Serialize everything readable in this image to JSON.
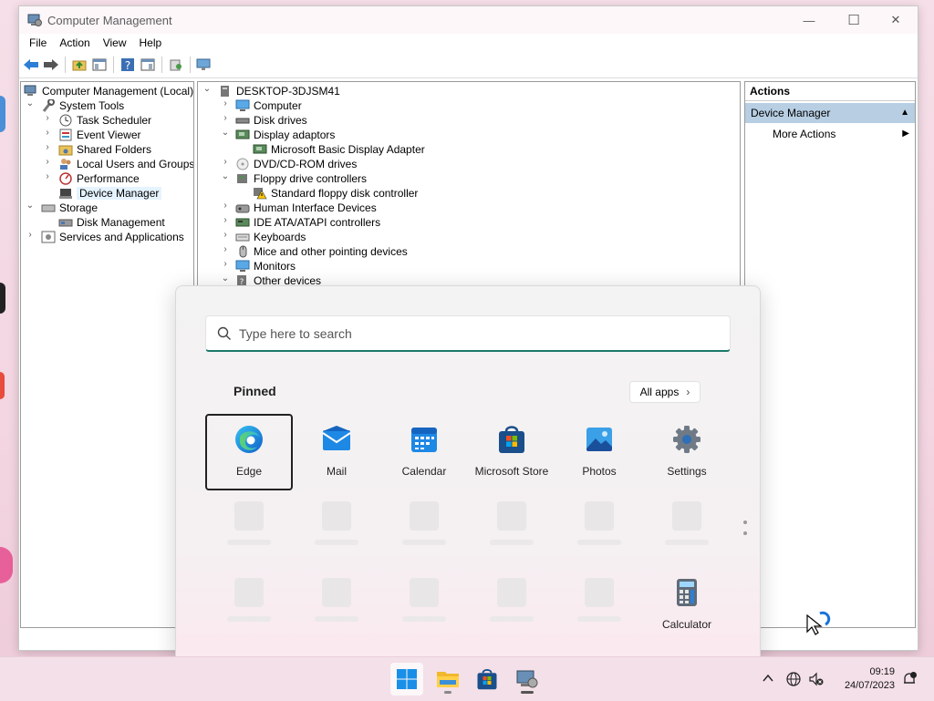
{
  "window": {
    "title": "Computer Management",
    "controls": {
      "minimize": "—",
      "maximize": "☐",
      "close": "✕"
    }
  },
  "menubar": [
    "File",
    "Action",
    "View",
    "Help"
  ],
  "left_tree": {
    "root": "Computer Management (Local)",
    "system_tools": "System Tools",
    "task_scheduler": "Task Scheduler",
    "event_viewer": "Event Viewer",
    "shared_folders": "Shared Folders",
    "local_users": "Local Users and Groups",
    "performance": "Performance",
    "device_manager": "Device Manager",
    "storage": "Storage",
    "disk_management": "Disk Management",
    "services": "Services and Applications"
  },
  "device_tree": {
    "root": "DESKTOP-3DJSM41",
    "computer": "Computer",
    "disk_drives": "Disk drives",
    "display_adaptors": "Display adaptors",
    "display_child": "Microsoft Basic Display Adapter",
    "dvd": "DVD/CD-ROM drives",
    "floppy": "Floppy drive controllers",
    "floppy_child": "Standard floppy disk controller",
    "hid": "Human Interface Devices",
    "ide": "IDE ATA/ATAPI controllers",
    "keyboards": "Keyboards",
    "mice": "Mice and other pointing devices",
    "monitors": "Monitors",
    "other": "Other devices"
  },
  "actions": {
    "header": "Actions",
    "section": "Device Manager",
    "more": "More Actions"
  },
  "start_menu": {
    "search_placeholder": "Type here to search",
    "pinned_label": "Pinned",
    "all_apps_label": "All apps",
    "apps": {
      "edge": "Edge",
      "mail": "Mail",
      "calendar": "Calendar",
      "store": "Microsoft Store",
      "photos": "Photos",
      "settings": "Settings",
      "calculator": "Calculator"
    }
  },
  "taskbar": {
    "time": "09:19",
    "date": "24/07/2023"
  }
}
